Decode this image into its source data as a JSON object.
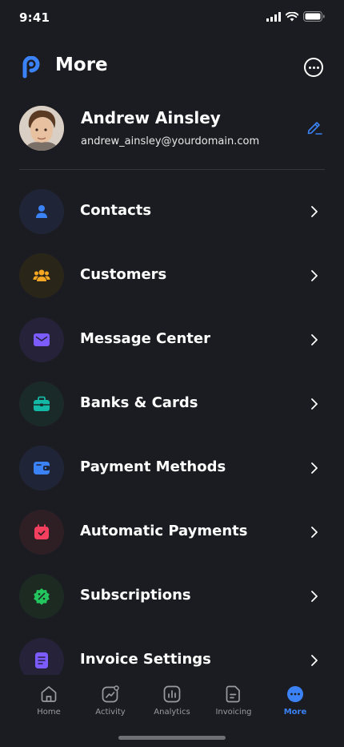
{
  "status_bar": {
    "time": "9:41"
  },
  "header": {
    "title": "More",
    "logo_icon": "app-logo-icon",
    "menu_icon": "more-options-icon"
  },
  "profile": {
    "name": "Andrew Ainsley",
    "email": "andrew_ainsley@yourdomain.com",
    "edit_icon": "edit-pen-icon"
  },
  "menu": {
    "items": [
      {
        "label": "Contacts",
        "icon": "person-icon",
        "bg": "#1f2537",
        "color": "#3b82f6"
      },
      {
        "label": "Customers",
        "icon": "users-group-icon",
        "bg": "#2a2519",
        "color": "#f5a623"
      },
      {
        "label": "Message Center",
        "icon": "mail-icon",
        "bg": "#25223a",
        "color": "#7c5cff"
      },
      {
        "label": "Banks & Cards",
        "icon": "briefcase-icon",
        "bg": "#1a2a28",
        "color": "#14b8a6"
      },
      {
        "label": "Payment Methods",
        "icon": "wallet-icon",
        "bg": "#1f2537",
        "color": "#3b82f6"
      },
      {
        "label": "Automatic Payments",
        "icon": "calendar-check-icon",
        "bg": "#2e1f25",
        "color": "#f43f5e"
      },
      {
        "label": "Subscriptions",
        "icon": "discount-badge-icon",
        "bg": "#1c2a22",
        "color": "#22c55e"
      },
      {
        "label": "Invoice Settings",
        "icon": "document-icon",
        "bg": "#25223a",
        "color": "#7c5cff"
      }
    ]
  },
  "tabbar": {
    "items": [
      {
        "label": "Home",
        "icon": "home-icon",
        "active": false
      },
      {
        "label": "Activity",
        "icon": "activity-icon",
        "active": false
      },
      {
        "label": "Analytics",
        "icon": "analytics-icon",
        "active": false
      },
      {
        "label": "Invoicing",
        "icon": "invoice-icon",
        "active": false
      },
      {
        "label": "More",
        "icon": "more-icon",
        "active": true
      }
    ]
  },
  "colors": {
    "accent": "#3b82f6",
    "background": "#1b1c21"
  }
}
